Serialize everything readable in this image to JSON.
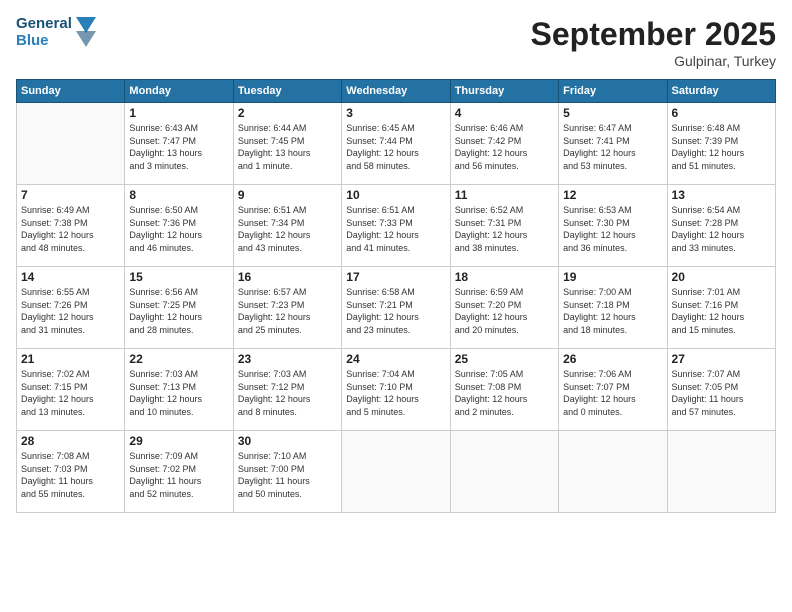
{
  "logo": {
    "line1": "General",
    "line2": "Blue"
  },
  "title": "September 2025",
  "subtitle": "Gulpinar, Turkey",
  "days_header": [
    "Sunday",
    "Monday",
    "Tuesday",
    "Wednesday",
    "Thursday",
    "Friday",
    "Saturday"
  ],
  "weeks": [
    [
      {
        "day": "",
        "info": ""
      },
      {
        "day": "1",
        "info": "Sunrise: 6:43 AM\nSunset: 7:47 PM\nDaylight: 13 hours\nand 3 minutes."
      },
      {
        "day": "2",
        "info": "Sunrise: 6:44 AM\nSunset: 7:45 PM\nDaylight: 13 hours\nand 1 minute."
      },
      {
        "day": "3",
        "info": "Sunrise: 6:45 AM\nSunset: 7:44 PM\nDaylight: 12 hours\nand 58 minutes."
      },
      {
        "day": "4",
        "info": "Sunrise: 6:46 AM\nSunset: 7:42 PM\nDaylight: 12 hours\nand 56 minutes."
      },
      {
        "day": "5",
        "info": "Sunrise: 6:47 AM\nSunset: 7:41 PM\nDaylight: 12 hours\nand 53 minutes."
      },
      {
        "day": "6",
        "info": "Sunrise: 6:48 AM\nSunset: 7:39 PM\nDaylight: 12 hours\nand 51 minutes."
      }
    ],
    [
      {
        "day": "7",
        "info": "Sunrise: 6:49 AM\nSunset: 7:38 PM\nDaylight: 12 hours\nand 48 minutes."
      },
      {
        "day": "8",
        "info": "Sunrise: 6:50 AM\nSunset: 7:36 PM\nDaylight: 12 hours\nand 46 minutes."
      },
      {
        "day": "9",
        "info": "Sunrise: 6:51 AM\nSunset: 7:34 PM\nDaylight: 12 hours\nand 43 minutes."
      },
      {
        "day": "10",
        "info": "Sunrise: 6:51 AM\nSunset: 7:33 PM\nDaylight: 12 hours\nand 41 minutes."
      },
      {
        "day": "11",
        "info": "Sunrise: 6:52 AM\nSunset: 7:31 PM\nDaylight: 12 hours\nand 38 minutes."
      },
      {
        "day": "12",
        "info": "Sunrise: 6:53 AM\nSunset: 7:30 PM\nDaylight: 12 hours\nand 36 minutes."
      },
      {
        "day": "13",
        "info": "Sunrise: 6:54 AM\nSunset: 7:28 PM\nDaylight: 12 hours\nand 33 minutes."
      }
    ],
    [
      {
        "day": "14",
        "info": "Sunrise: 6:55 AM\nSunset: 7:26 PM\nDaylight: 12 hours\nand 31 minutes."
      },
      {
        "day": "15",
        "info": "Sunrise: 6:56 AM\nSunset: 7:25 PM\nDaylight: 12 hours\nand 28 minutes."
      },
      {
        "day": "16",
        "info": "Sunrise: 6:57 AM\nSunset: 7:23 PM\nDaylight: 12 hours\nand 25 minutes."
      },
      {
        "day": "17",
        "info": "Sunrise: 6:58 AM\nSunset: 7:21 PM\nDaylight: 12 hours\nand 23 minutes."
      },
      {
        "day": "18",
        "info": "Sunrise: 6:59 AM\nSunset: 7:20 PM\nDaylight: 12 hours\nand 20 minutes."
      },
      {
        "day": "19",
        "info": "Sunrise: 7:00 AM\nSunset: 7:18 PM\nDaylight: 12 hours\nand 18 minutes."
      },
      {
        "day": "20",
        "info": "Sunrise: 7:01 AM\nSunset: 7:16 PM\nDaylight: 12 hours\nand 15 minutes."
      }
    ],
    [
      {
        "day": "21",
        "info": "Sunrise: 7:02 AM\nSunset: 7:15 PM\nDaylight: 12 hours\nand 13 minutes."
      },
      {
        "day": "22",
        "info": "Sunrise: 7:03 AM\nSunset: 7:13 PM\nDaylight: 12 hours\nand 10 minutes."
      },
      {
        "day": "23",
        "info": "Sunrise: 7:03 AM\nSunset: 7:12 PM\nDaylight: 12 hours\nand 8 minutes."
      },
      {
        "day": "24",
        "info": "Sunrise: 7:04 AM\nSunset: 7:10 PM\nDaylight: 12 hours\nand 5 minutes."
      },
      {
        "day": "25",
        "info": "Sunrise: 7:05 AM\nSunset: 7:08 PM\nDaylight: 12 hours\nand 2 minutes."
      },
      {
        "day": "26",
        "info": "Sunrise: 7:06 AM\nSunset: 7:07 PM\nDaylight: 12 hours\nand 0 minutes."
      },
      {
        "day": "27",
        "info": "Sunrise: 7:07 AM\nSunset: 7:05 PM\nDaylight: 11 hours\nand 57 minutes."
      }
    ],
    [
      {
        "day": "28",
        "info": "Sunrise: 7:08 AM\nSunset: 7:03 PM\nDaylight: 11 hours\nand 55 minutes."
      },
      {
        "day": "29",
        "info": "Sunrise: 7:09 AM\nSunset: 7:02 PM\nDaylight: 11 hours\nand 52 minutes."
      },
      {
        "day": "30",
        "info": "Sunrise: 7:10 AM\nSunset: 7:00 PM\nDaylight: 11 hours\nand 50 minutes."
      },
      {
        "day": "",
        "info": ""
      },
      {
        "day": "",
        "info": ""
      },
      {
        "day": "",
        "info": ""
      },
      {
        "day": "",
        "info": ""
      }
    ]
  ]
}
